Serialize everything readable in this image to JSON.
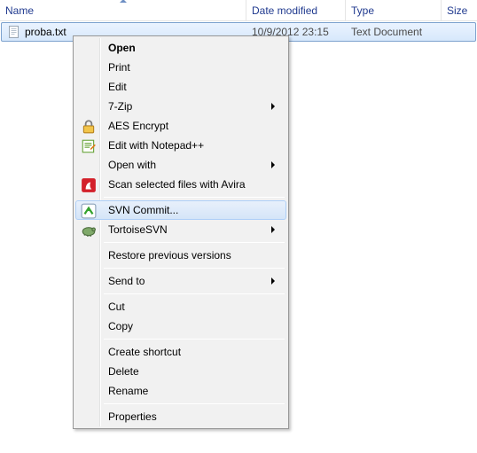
{
  "columns": {
    "name": "Name",
    "date": "Date modified",
    "type": "Type",
    "size": "Size"
  },
  "file": {
    "name": "proba.txt",
    "date": "10/9/2012 23:15",
    "type": "Text Document"
  },
  "menu": {
    "open": "Open",
    "print": "Print",
    "edit": "Edit",
    "sevenzip": "7-Zip",
    "aes": "AES Encrypt",
    "npp": "Edit with Notepad++",
    "openwith": "Open with",
    "avira": "Scan selected files with Avira",
    "svncommit": "SVN Commit...",
    "tortoisesvn": "TortoiseSVN",
    "restore": "Restore previous versions",
    "sendto": "Send to",
    "cut": "Cut",
    "copy": "Copy",
    "shortcut": "Create shortcut",
    "delete": "Delete",
    "rename": "Rename",
    "properties": "Properties"
  }
}
